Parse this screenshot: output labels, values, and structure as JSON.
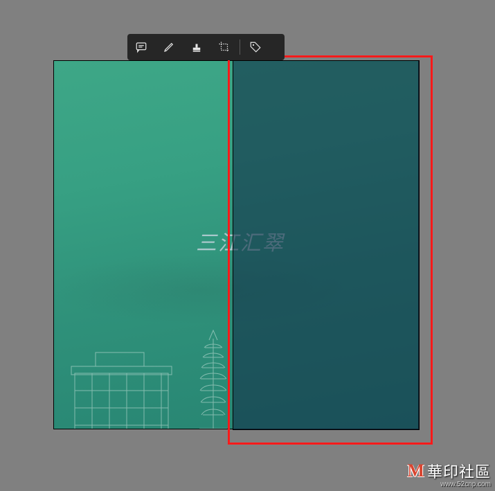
{
  "toolbar": {
    "items": [
      {
        "name": "comment-icon"
      },
      {
        "name": "pencil-icon"
      },
      {
        "name": "stamp-icon"
      },
      {
        "name": "crop-icon"
      },
      {
        "name": "tag-icon"
      }
    ]
  },
  "artwork": {
    "title": "三江汇翠"
  },
  "watermark": {
    "logo_glyph": "M",
    "brand": "華印社區",
    "url": "www.52cnp.com"
  }
}
